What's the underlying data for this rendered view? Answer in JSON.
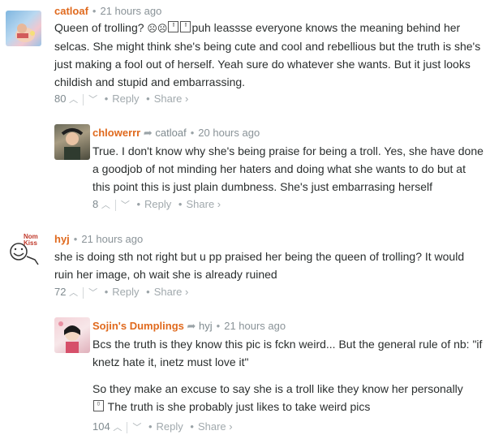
{
  "comments": [
    {
      "author": "catloaf",
      "parent": "",
      "time": "21 hours ago",
      "text_prefix": "Queen of trolling? ",
      "emoji": "☹☹",
      "text_suffix": "puh leassse everyone knows the meaning behind her selcas. She might think she's being cute and cool and rebellious but the truth is she's just making a fool out of herself. Yeah sure do whatever she wants. But it just looks childish and stupid and embarrassing.",
      "votes": "80",
      "reply": "Reply",
      "share": "Share ›"
    },
    {
      "author": "chlowerrr",
      "parent": "catloaf",
      "time": "20 hours ago",
      "text": "True. I don't know why she's being praise for being a troll. Yes, she have done a goodjob of not minding her haters and doing what she wants to do but at this point this is just plain dumbness. She's just embarrasing herself",
      "votes": "8",
      "reply": "Reply",
      "share": "Share ›"
    },
    {
      "author": "hyj",
      "parent": "",
      "time": "21 hours ago",
      "text": "she is doing sth not right but u pp praised her being the queen of trolling? It would ruin her image, oh wait she is already ruined",
      "votes": "72",
      "reply": "Reply",
      "share": "Share ›"
    },
    {
      "author": "Sojin's Dumplings",
      "parent": "hyj",
      "time": "21 hours ago",
      "text1": "Bcs the truth is they know this pic is fckn weird... But the general rule of nb: \"if knetz hate it, inetz must love it\"",
      "text2": "So they make an excuse to say she is a troll like they know her personally",
      "text3": " The truth is she probably just likes to take weird pics",
      "votes": "104",
      "reply": "Reply",
      "share": "Share ›"
    }
  ],
  "avatar3_caption": "Nom Kiss"
}
